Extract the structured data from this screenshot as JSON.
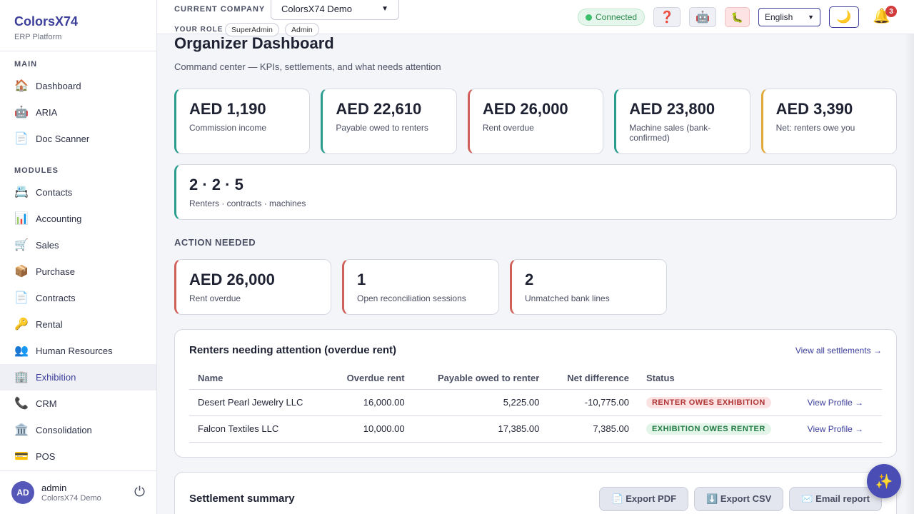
{
  "brand": {
    "title": "ColorsX74",
    "subtitle": "ERP Platform"
  },
  "sidebar": {
    "main_label": "MAIN",
    "main_items": [
      {
        "label": "Dashboard",
        "icon": "🏠"
      },
      {
        "label": "ARIA",
        "icon": "🤖"
      },
      {
        "label": "Doc Scanner",
        "icon": "📄"
      }
    ],
    "modules_label": "MODULES",
    "module_items": [
      {
        "label": "Contacts",
        "icon": "📇"
      },
      {
        "label": "Accounting",
        "icon": "📊"
      },
      {
        "label": "Sales",
        "icon": "🛒"
      },
      {
        "label": "Purchase",
        "icon": "📦"
      },
      {
        "label": "Contracts",
        "icon": "📄"
      },
      {
        "label": "Rental",
        "icon": "🔑"
      },
      {
        "label": "Human Resources",
        "icon": "👥"
      },
      {
        "label": "Exhibition",
        "icon": "🏢",
        "active": true
      },
      {
        "label": "CRM",
        "icon": "📞"
      },
      {
        "label": "Consolidation",
        "icon": "🏛️"
      },
      {
        "label": "POS",
        "icon": "💳"
      }
    ],
    "user": {
      "initials": "AD",
      "name": "admin",
      "company": "ColorsX74 Demo"
    }
  },
  "topbar": {
    "company_label": "CURRENT COMPANY",
    "company_value": "ColorsX74 Demo",
    "role_label": "YOUR ROLE",
    "roles": [
      "SuperAdmin",
      "Admin"
    ],
    "status": "Connected",
    "language": "English",
    "notifications": "3",
    "icons": {
      "help": "❓",
      "robot": "🤖",
      "bug": "🐛",
      "moon": "🌙",
      "bell": "🔔",
      "power": "⏻"
    }
  },
  "page": {
    "title": "Organizer Dashboard",
    "subtitle": "Command center — KPIs, settlements, and what needs attention"
  },
  "kpis": [
    {
      "value": "AED 1,190",
      "label": "Commission income",
      "color": "#2a9d8f"
    },
    {
      "value": "AED 22,610",
      "label": "Payable owed to renters",
      "color": "#2a9d8f"
    },
    {
      "value": "AED 26,000",
      "label": "Rent overdue",
      "color": "#d0605a"
    },
    {
      "value": "AED 23,800",
      "label": "Machine sales (bank-confirmed)",
      "color": "#2a9d8f"
    },
    {
      "value": "AED 3,390",
      "label": "Net: renters owe you",
      "color": "#e0a93a"
    }
  ],
  "summary_kpi": {
    "value": "2 · 2 · 5",
    "label": "Renters · contracts · machines"
  },
  "action": {
    "title": "ACTION NEEDED",
    "cards": [
      {
        "value": "AED 26,000",
        "label": "Rent overdue"
      },
      {
        "value": "1",
        "label": "Open reconciliation sessions"
      },
      {
        "value": "2",
        "label": "Unmatched bank lines"
      }
    ]
  },
  "renters": {
    "title": "Renters needing attention (overdue rent)",
    "link": "View all settlements →",
    "columns": [
      "Name",
      "Overdue rent",
      "Payable owed to renter",
      "Net difference",
      "Status",
      ""
    ],
    "rows": [
      {
        "name": "Desert Pearl Jewelry LLC",
        "overdue": "16,000.00",
        "payable": "5,225.00",
        "net": "-10,775.00",
        "status": "RENTER OWES EXHIBITION",
        "status_type": "red",
        "action": "View Profile →"
      },
      {
        "name": "Falcon Textiles LLC",
        "overdue": "10,000.00",
        "payable": "17,385.00",
        "net": "7,385.00",
        "status": "EXHIBITION OWES RENTER",
        "status_type": "green",
        "action": "View Profile →"
      }
    ]
  },
  "settlement": {
    "title": "Settlement summary",
    "buttons": [
      {
        "label": "📄 Export PDF"
      },
      {
        "label": "⬇️ Export CSV"
      },
      {
        "label": "✉️ Email report"
      }
    ]
  },
  "fab_icon": "✨"
}
